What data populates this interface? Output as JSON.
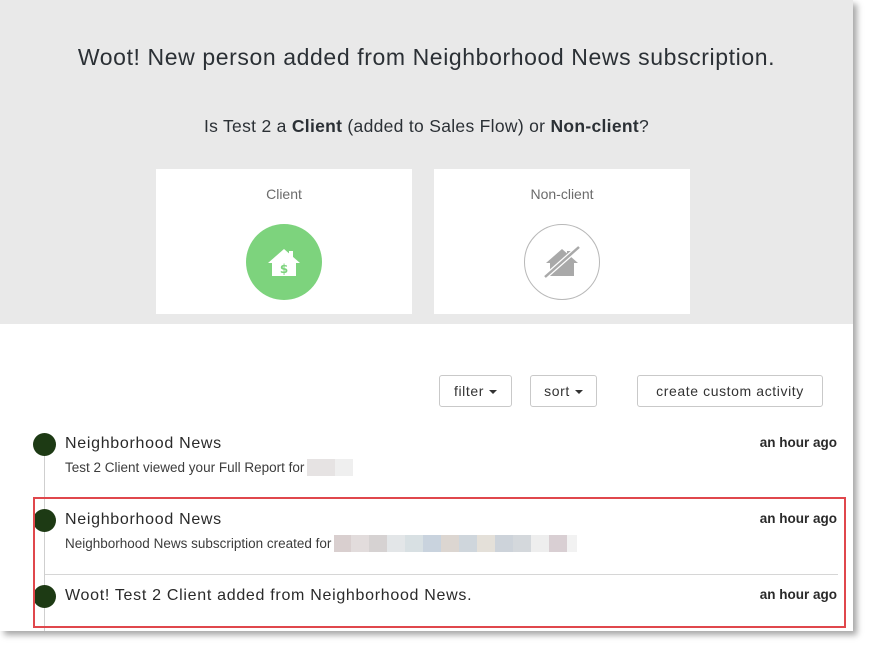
{
  "hero": {
    "title": "Woot! New person added from Neighborhood News subscription.",
    "question": {
      "prefix": "Is Test 2 a ",
      "client_word": "Client",
      "middle": " (added to Sales Flow) or ",
      "nonclient_word": "Non-client",
      "suffix": "?"
    },
    "choices": [
      {
        "label": "Client",
        "icon": "house-dollar-icon",
        "color": "#7dd37d"
      },
      {
        "label": "Non-client",
        "icon": "house-crossed-icon",
        "color": "#b0b0b0"
      }
    ]
  },
  "toolbar": {
    "filter_label": "filter",
    "sort_label": "sort",
    "custom_label": "create custom activity"
  },
  "activities": [
    {
      "title": "Neighborhood News",
      "description": "Test 2 Client viewed your Full Report for",
      "time": "an hour ago"
    },
    {
      "title": "Neighborhood News",
      "description": "Neighborhood News subscription created for",
      "time": "an hour ago"
    },
    {
      "title": "Woot! Test 2 Client added from Neighborhood News.",
      "description": "",
      "time": "an hour ago"
    }
  ],
  "colors": {
    "dot": "#1d3a14",
    "highlight": "#e0474c",
    "hero_bg": "#e9e9e9"
  }
}
